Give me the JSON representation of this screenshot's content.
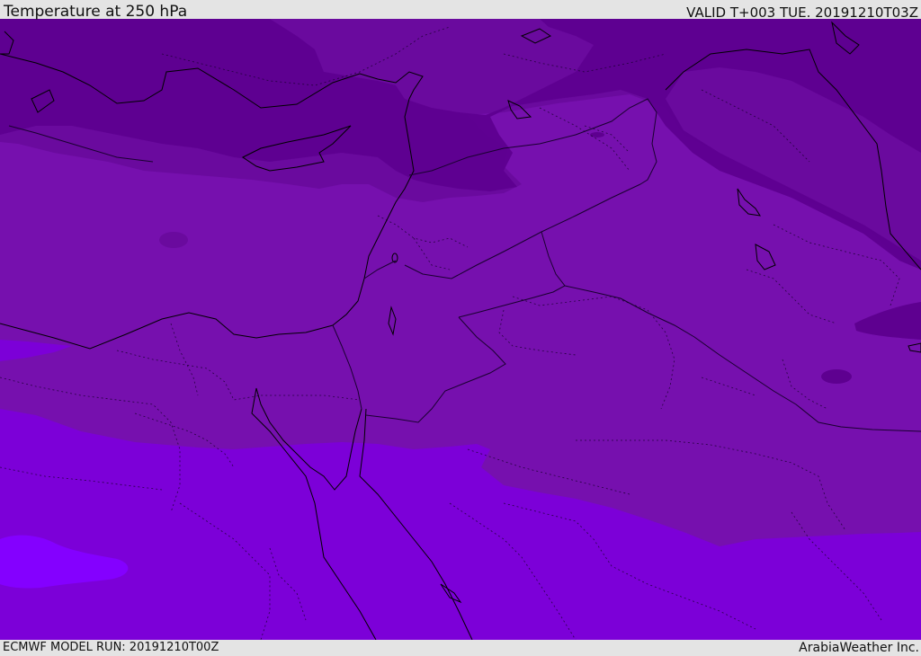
{
  "header": {
    "title": "Temperature at 250 hPa",
    "valid": "VALID T+003 TUE. 20191210T03Z"
  },
  "footer": {
    "model_run": "ECMWF MODEL RUN: 20191210T00Z",
    "credit": "ArabiaWeather Inc."
  },
  "map": {
    "field": "Temperature at 250 hPa",
    "colors": {
      "coldest": "#5e0090",
      "cold": "#6a0a9e",
      "mid": "#7610ae",
      "warm": "#7c00d8",
      "warmest": "#8400ff",
      "coast_line": "#000000",
      "border_line": "#1a0030"
    }
  }
}
